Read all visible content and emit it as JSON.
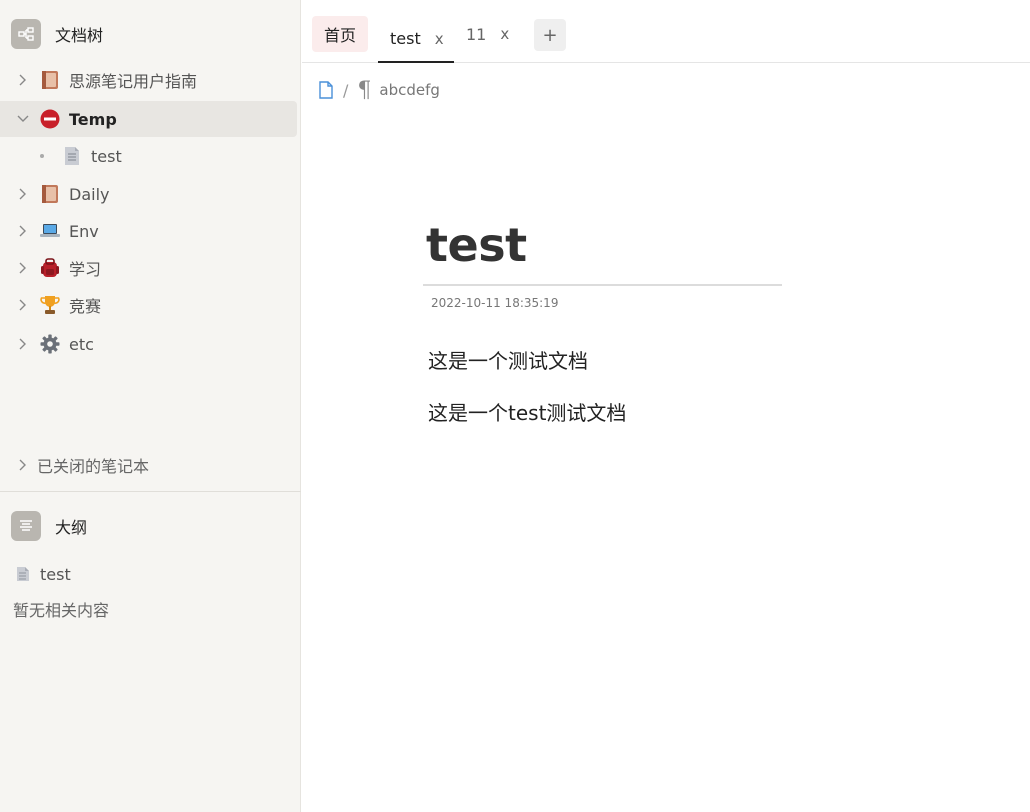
{
  "sidebar": {
    "doc_tree": {
      "title": "文档树",
      "items": [
        {
          "label": "思源笔记用户指南",
          "icon": "book-icon"
        },
        {
          "label": "Temp",
          "icon": "no-entry-icon"
        },
        {
          "label": "test",
          "icon": "document-icon"
        },
        {
          "label": "Daily",
          "icon": "book-icon"
        },
        {
          "label": "Env",
          "icon": "laptop-icon"
        },
        {
          "label": "学习",
          "icon": "backpack-icon"
        },
        {
          "label": "竞赛",
          "icon": "trophy-icon"
        },
        {
          "label": "etc",
          "icon": "gear-icon"
        }
      ],
      "closed_notebooks": "已关闭的笔记本"
    },
    "outline": {
      "title": "大纲",
      "doc_label": "test",
      "empty_text": "暂无相关内容"
    }
  },
  "tabs": [
    {
      "label": "首页"
    },
    {
      "label": "test",
      "close": "x"
    },
    {
      "label": "11",
      "close": "x"
    }
  ],
  "tab_add": "+",
  "breadcrumb": {
    "separator": "/",
    "block_label": "abcdefg"
  },
  "document": {
    "title": "test",
    "timestamp": "2022-10-11 18:35:19",
    "paragraphs": [
      "这是一个测试文档",
      "这是一个test测试文档"
    ]
  }
}
